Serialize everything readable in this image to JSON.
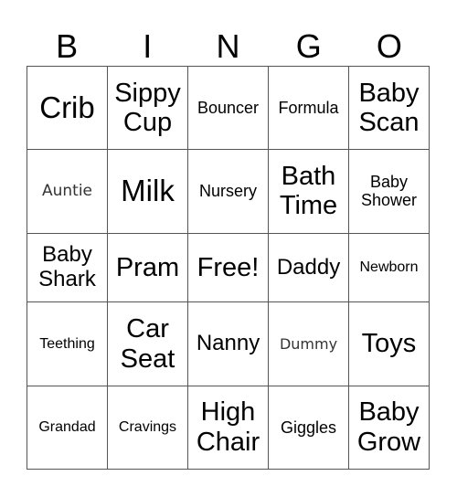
{
  "header": [
    "B",
    "I",
    "N",
    "G",
    "O"
  ],
  "cells": [
    [
      "Crib",
      "Sippy Cup",
      "Bouncer",
      "Formula",
      "Baby Scan"
    ],
    [
      "Auntie",
      "Milk",
      "Nursery",
      "Bath Time",
      "Baby Shower"
    ],
    [
      "Baby Shark",
      "Pram",
      "Free!",
      "Daddy",
      "Newborn"
    ],
    [
      "Teething",
      "Car Seat",
      "Nanny",
      "Dummy",
      "Toys"
    ],
    [
      "Grandad",
      "Cravings",
      "High Chair",
      "Giggles",
      "Baby Grow"
    ]
  ]
}
